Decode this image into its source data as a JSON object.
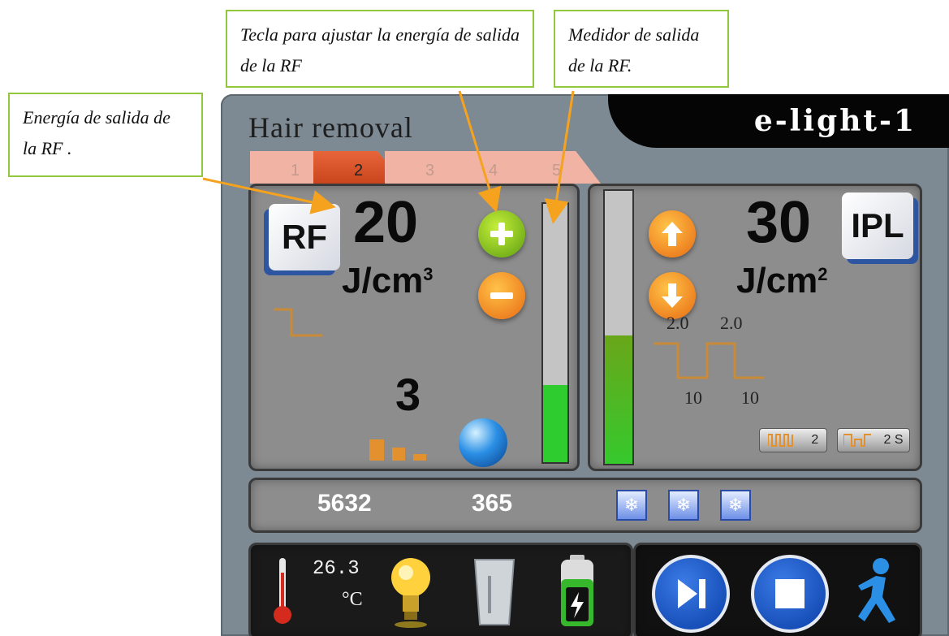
{
  "callouts": {
    "tecla": "Tecla para ajustar la energía de salida de la RF",
    "medidor": "Medidor de salida de la RF.",
    "energia": "Energía de salida de la RF ."
  },
  "header": {
    "title": "Hair removal",
    "brand": "e-light-1"
  },
  "tabs": [
    {
      "label": "1"
    },
    {
      "label": "2"
    },
    {
      "label": "3"
    },
    {
      "label": "4"
    },
    {
      "label": "5"
    }
  ],
  "active_tab": "2",
  "rf": {
    "badge": "RF",
    "energy": "20",
    "unit": "J/cm",
    "unit_exp": "3",
    "level": "3",
    "meter_fill_pct": 30
  },
  "ipl": {
    "badge": "IPL",
    "energy": "30",
    "unit": "J/cm",
    "unit_exp": "2",
    "pulse_top_1": "2.0",
    "pulse_top_2": "2.0",
    "pulse_bottom_1": "10",
    "pulse_bottom_2": "10",
    "pulse_count": "2",
    "interval": "2 S",
    "meter_fill_pct": 47
  },
  "counters": {
    "total": "5632",
    "session": "365"
  },
  "status": {
    "temperature": "26.3",
    "temp_unit": "°C"
  },
  "colors": {
    "meter_green": "#2ecc2e",
    "meter_olive": "#6aa61a",
    "orange": "#f08a1d",
    "blue": "#0f4fc0"
  },
  "icons": [
    "plus-icon",
    "minus-icon",
    "arrow-up-icon",
    "arrow-down-icon",
    "snowflake-icon",
    "thermometer-icon",
    "bulb-icon",
    "water-tank-icon",
    "battery-icon",
    "play-step-icon",
    "stop-icon",
    "runner-icon"
  ]
}
